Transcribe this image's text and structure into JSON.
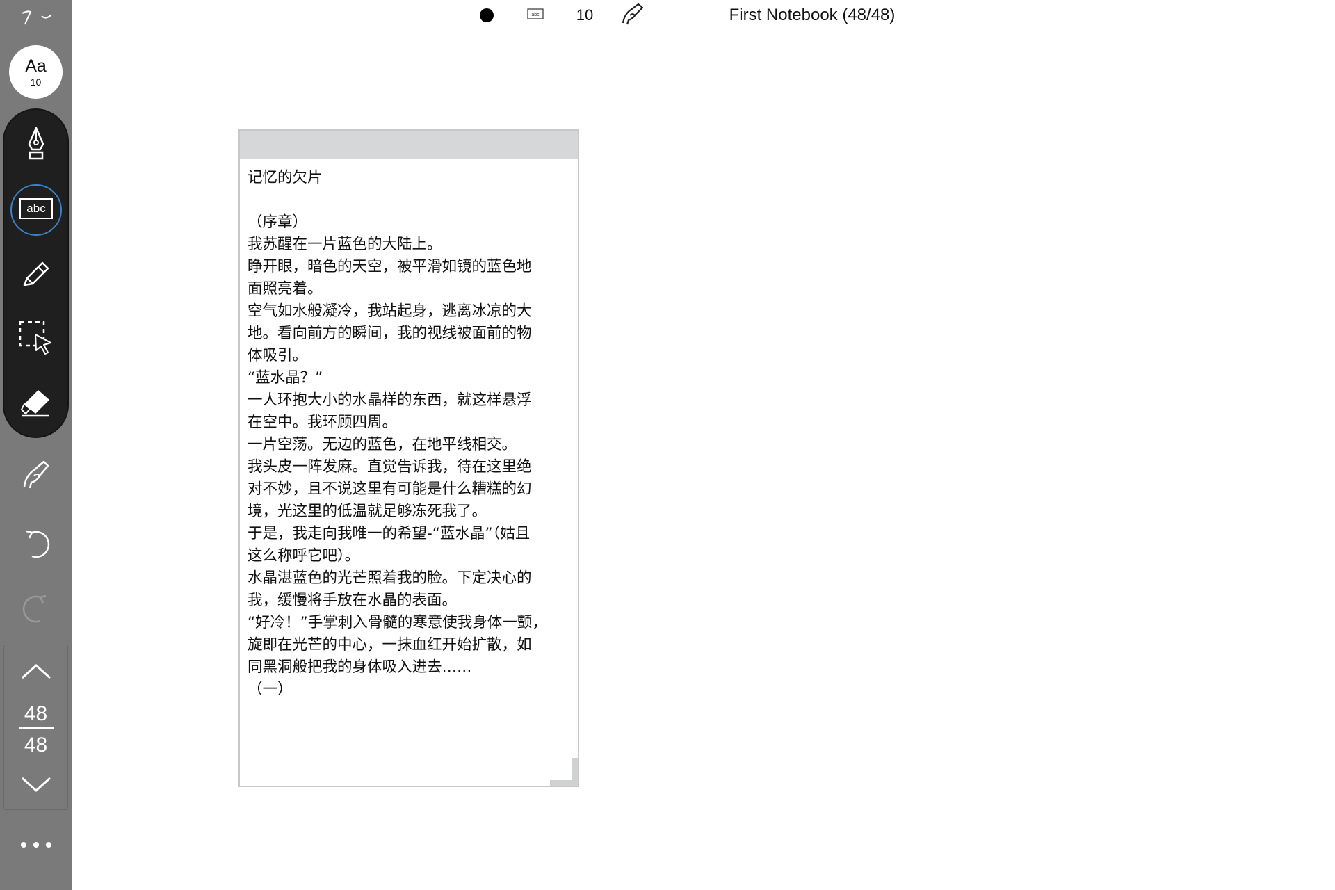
{
  "toolbar": {
    "top_icon": "collapse-icon",
    "font_size_button": {
      "label": "Aa",
      "value": "10"
    },
    "tools": [
      {
        "name": "pen-tool",
        "icon": "fountain-pen-icon"
      },
      {
        "name": "text-tool",
        "icon": "text-box-icon",
        "label": "abc",
        "selected": true
      },
      {
        "name": "highlighter-tool",
        "icon": "highlighter-icon"
      },
      {
        "name": "lasso-select-tool",
        "icon": "lasso-select-icon"
      },
      {
        "name": "eraser-tool",
        "icon": "eraser-icon"
      }
    ],
    "gesture_icon": "hand-pen-icon",
    "undo_icon": "undo-icon",
    "redo_icon": "redo-icon",
    "page_nav": {
      "current": "48",
      "total": "48",
      "up_icon": "chevron-up-icon",
      "down_icon": "chevron-down-icon"
    },
    "more_icon": "more-icon"
  },
  "topbar": {
    "color": "#000000",
    "tool_icon": "text-box-icon",
    "tool_icon_label": "abc",
    "size": "10",
    "gesture_icon": "hand-pen-icon",
    "notebook_title": "First Notebook (48/48)"
  },
  "textbox": {
    "lines": [
      "记忆的欠片",
      "",
      "（序章）",
      "我苏醒在一片蓝色的大陆上。",
      "睁开眼，暗色的天空，被平滑如镜的蓝色地",
      "面照亮着。",
      "空气如水般凝冷，我站起身，逃离冰凉的大",
      "地。看向前方的瞬间，我的视线被面前的物",
      "体吸引。",
      "“蓝水晶？”",
      "一人环抱大小的水晶样的东西，就这样悬浮",
      "在空中。我环顾四周。",
      "一片空荡。无边的蓝色，在地平线相交。",
      "我头皮一阵发麻。直觉告诉我，待在这里绝",
      "对不妙，且不说这里有可能是什么糟糕的幻",
      "境，光这里的低温就足够冻死我了。",
      "于是，我走向我唯一的希望-“蓝水晶”（姑且",
      "这么称呼它吧）。",
      "水晶湛蓝色的光芒照着我的脸。下定决心的",
      "我，缓慢将手放在水晶的表面。",
      "“好冷！”手掌刺入骨髓的寒意使我身体一颤，",
      "旋即在光芒的中心，一抹血红开始扩散，如",
      "同黑洞般把我的身体吸入进去……",
      "（一）"
    ]
  }
}
